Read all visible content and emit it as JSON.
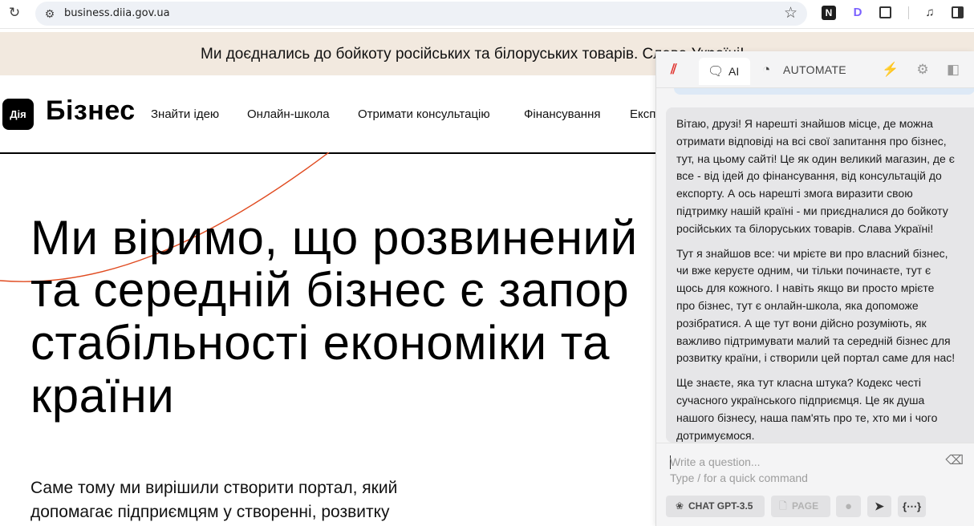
{
  "browser": {
    "reload_icon": "reload-icon",
    "url": "business.diia.gov.ua",
    "extensions": [
      "N",
      "D"
    ]
  },
  "banner": {
    "text": "Ми доєднались до бойкоту російських та білоруських товарів. Слава Україні!"
  },
  "site": {
    "logo": "Дія",
    "brand": "Бізнес",
    "nav": [
      "Знайти ідею",
      "Онлайн-школа",
      "Отримати консультацію",
      "Фінансування",
      "Експ"
    ]
  },
  "hero": {
    "lines": [
      "Ми віримо, що розвинений",
      "та середній бізнес є запор",
      "стабільності економіки та",
      "країни"
    ],
    "sub": [
      "Саме тому ми вирішили створити портал, який",
      "допомагає підприємцям у створенні, розвитку"
    ]
  },
  "panel": {
    "tabs": [
      {
        "label": "AI",
        "icon": "chat-icon",
        "active": true
      },
      {
        "label": "AUTOMATE",
        "icon": "gauge-icon",
        "active": false
      }
    ],
    "message_lines": [
      "Вітаю, друзі! Я нарешті знайшов місце, де можна",
      "отримати відповіді на всі свої запитання про бізнес,",
      "тут, на цьому сайті! Це як один великий магазин, де є",
      "все - від ідей до фінансування, від консультацій до",
      "експорту. А ось нарешті змога виразити свою",
      "підтримку нашій країні - ми приєдналися до бойкоту",
      "російських та білоруських товарів. Слава Україні!",
      "",
      "Тут я знайшов все: чи мрієте ви про власний бізнес,",
      "чи вже керуєте одним, чи тільки починаєте, тут є",
      "щось для кожного. І навіть якщо ви просто мрієте",
      "про бізнес, тут є онлайн-школа, яка допоможе",
      "розібратися. А ще тут вони дійсно розуміють, як",
      "важливо підтримувати малий та середній бізнес для",
      "розвитку країни, і створили цей портал саме для нас!",
      "",
      "Ще знаєте, яка тут класна штука? Кодекс честі",
      "сучасного українського підприємця. Це як душа",
      "нашого бізнесу, наша пам'ять про те, хто ми і чого",
      "дотримуємося."
    ],
    "input": {
      "placeholder_1": "Write a question...",
      "placeholder_2": "Type / for a quick command"
    },
    "toolbar": {
      "model": "CHAT GPT-3.5",
      "page": "PAGE"
    },
    "colors": {
      "accent": "#e0342f",
      "bubble": "#e6e6e8",
      "panel_bg": "#f4f4f5"
    }
  }
}
